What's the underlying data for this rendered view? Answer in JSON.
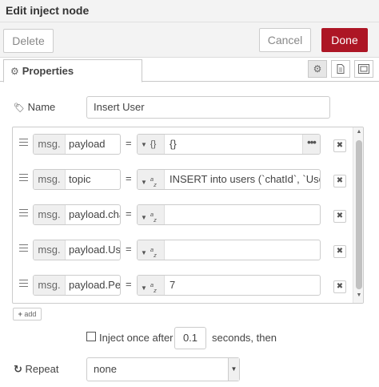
{
  "window": {
    "title": "Edit inject node"
  },
  "toolbar": {
    "delete_label": "Delete",
    "cancel_label": "Cancel",
    "done_label": "Done"
  },
  "tabs": {
    "properties_label": "Properties"
  },
  "name_field": {
    "label": "Name",
    "value": "Insert User"
  },
  "rows": [
    {
      "prefix": "msg.",
      "prop": "payload",
      "eq": "=",
      "type": "{}",
      "value": "{}"
    },
    {
      "prefix": "msg.",
      "prop": "topic",
      "eq": "=",
      "type_a": "a",
      "type_z": "z",
      "value": "INSERT into users (`chatId`, `UserN"
    },
    {
      "prefix": "msg.",
      "prop": "payload.chat",
      "eq": "=",
      "type_a": "a",
      "type_z": "z",
      "value": ""
    },
    {
      "prefix": "msg.",
      "prop": "payload.Use",
      "eq": "=",
      "type_a": "a",
      "type_z": "z",
      "value": ""
    },
    {
      "prefix": "msg.",
      "prop": "payload.Perr",
      "eq": "=",
      "type_a": "a",
      "type_z": "z",
      "value": "7"
    }
  ],
  "add_button": {
    "label": "add"
  },
  "inject_once": {
    "label": "Inject once after",
    "delay": "0.1",
    "suffix": "seconds, then"
  },
  "repeat": {
    "label": "Repeat",
    "selected": "none"
  }
}
